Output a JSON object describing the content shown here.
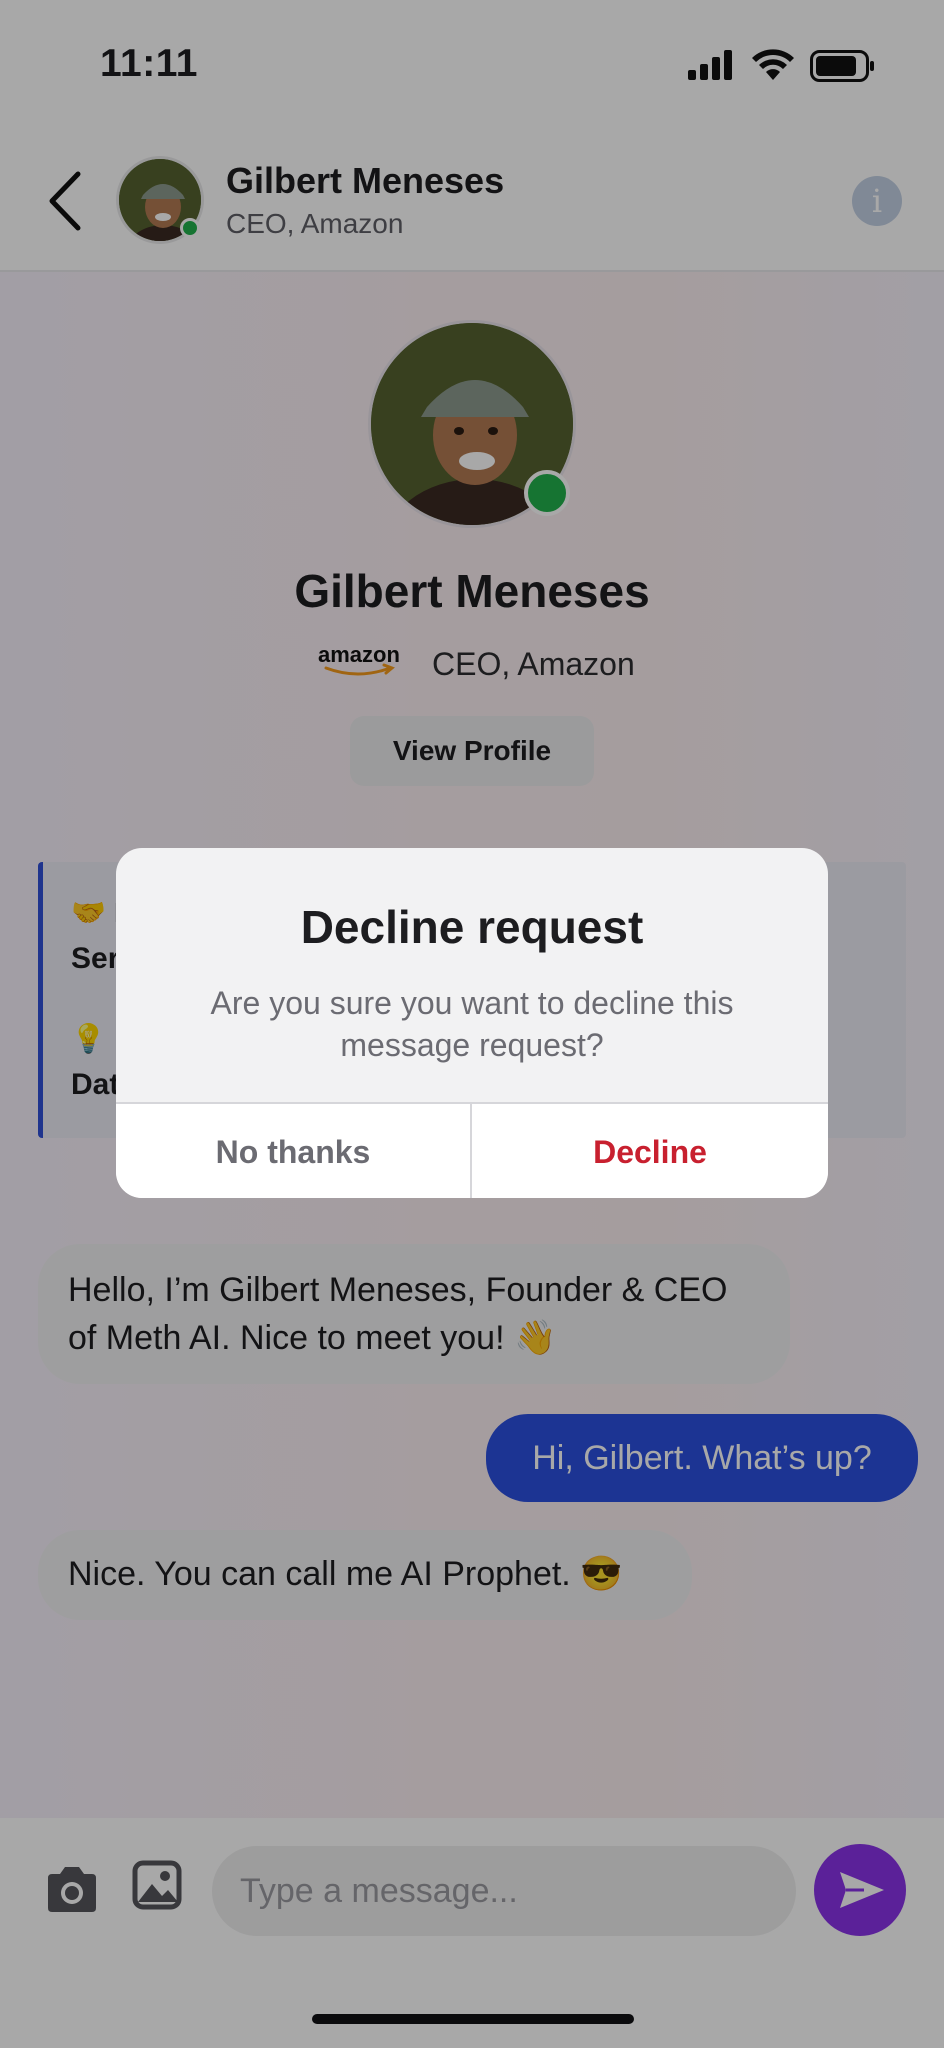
{
  "status_bar": {
    "time": "11:11",
    "icons": [
      "signal-icon",
      "wifi-icon",
      "battery-icon"
    ]
  },
  "header": {
    "name": "Gilbert Meneses",
    "subtitle": "CEO, Amazon",
    "online": true,
    "icons": [
      "back-icon",
      "info-icon"
    ]
  },
  "profile": {
    "name": "Gilbert Meneses",
    "company_logo": "amazon",
    "role": "CEO, Amazon",
    "view_profile_label": "View Profile"
  },
  "info_card": {
    "line1": "🤝 L",
    "line2": "Ser",
    "line3": "💡 I",
    "line4": "Dat"
  },
  "messages": [
    {
      "direction": "incoming",
      "text": "Hello, I’m Gilbert Meneses, Founder & CEO of Meth AI. Nice to meet you! 👋"
    },
    {
      "direction": "outgoing",
      "text": "Hi, Gilbert. What’s up?"
    },
    {
      "direction": "incoming",
      "text": "Nice. You can call me AI Prophet. 😎"
    }
  ],
  "composer": {
    "placeholder": "Type a message...",
    "icons": [
      "camera-icon",
      "gallery-icon",
      "send-icon"
    ]
  },
  "dialog": {
    "title": "Decline request",
    "message": "Are you sure you want to decline this message request?",
    "no_label": "No thanks",
    "decline_label": "Decline"
  },
  "colors": {
    "accent_blue": "#2b4fe0",
    "send_purple": "#8a33e8",
    "online_green": "#22b14c",
    "decline_red": "#c8202f"
  }
}
